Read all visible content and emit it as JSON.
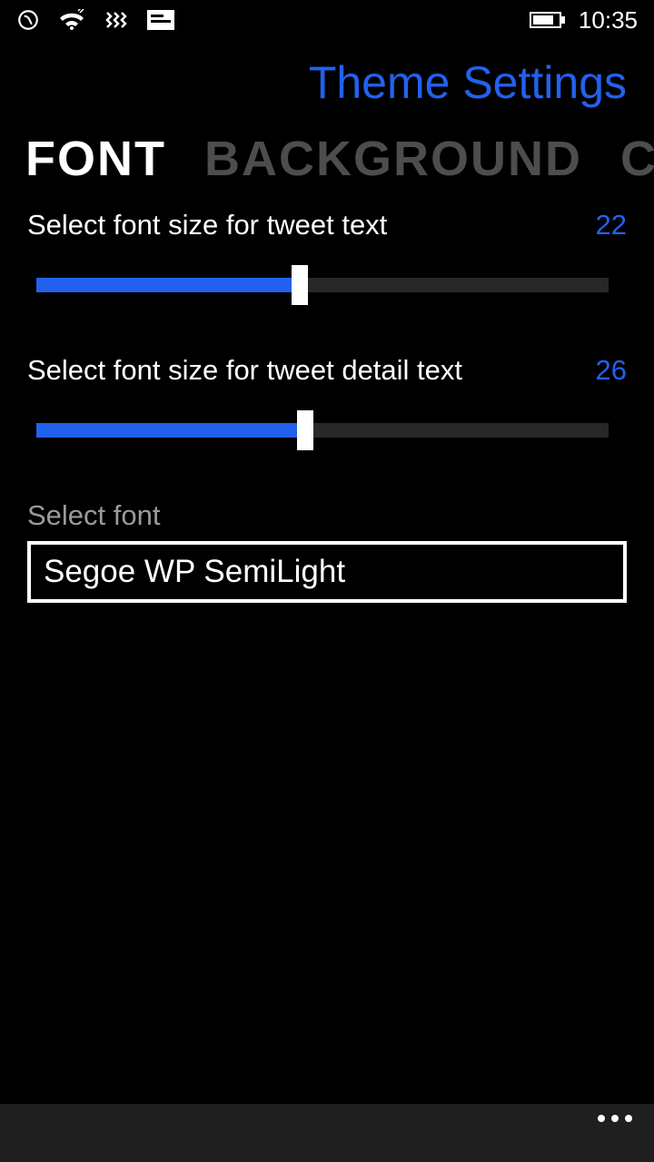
{
  "status": {
    "time": "10:35"
  },
  "header": {
    "page_title": "Theme Settings"
  },
  "pivot": {
    "tabs": [
      {
        "label": "FONT",
        "active": true
      },
      {
        "label": "BACKGROUND",
        "active": false
      },
      {
        "label": "C",
        "active": false
      }
    ]
  },
  "font_settings": {
    "tweet_text": {
      "label": "Select font size for tweet text",
      "value": "22",
      "fill_pct": 46
    },
    "tweet_detail": {
      "label": "Select font size for tweet detail text",
      "value": "26",
      "fill_pct": 47
    },
    "select_font": {
      "label": "Select font",
      "value": "Segoe WP SemiLight"
    }
  },
  "colors": {
    "accent": "#2261ee"
  }
}
